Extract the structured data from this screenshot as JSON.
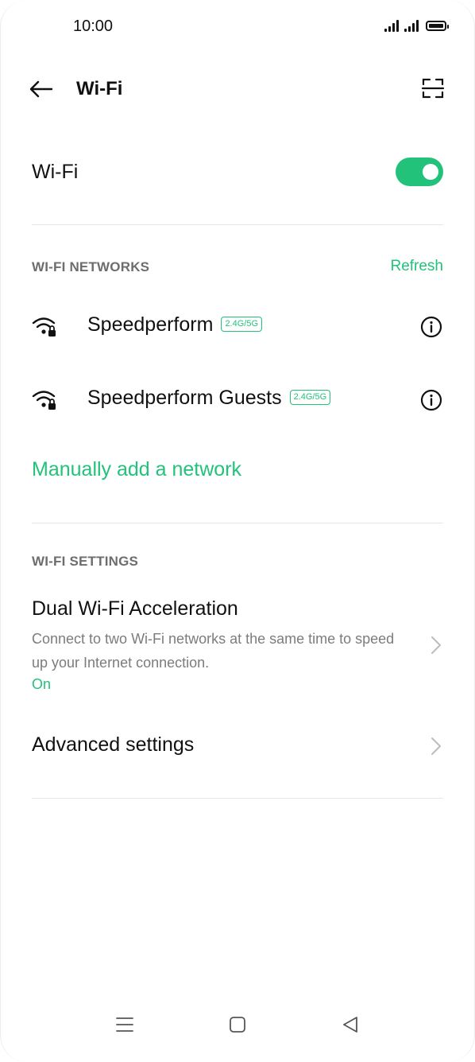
{
  "status_bar": {
    "time": "10:00",
    "icons": [
      "signal-icon",
      "signal-icon",
      "battery-icon"
    ]
  },
  "header": {
    "title": "Wi-Fi",
    "back_icon": "back-arrow-icon",
    "scan_icon": "qr-scan-icon"
  },
  "wifi_toggle": {
    "label": "Wi-Fi",
    "state": "on"
  },
  "networks_section": {
    "header": "WI-FI NETWORKS",
    "refresh_label": "Refresh",
    "networks": [
      {
        "name": "Speedperform",
        "band": "2.4G/5G",
        "icon": "wifi-locked-icon",
        "info_icon": "info-icon"
      },
      {
        "name": "Speedperform Guests",
        "band": "2.4G/5G",
        "icon": "wifi-locked-icon",
        "info_icon": "info-icon"
      }
    ],
    "manual_add_label": "Manually add a network"
  },
  "settings_section": {
    "header": "WI-FI SETTINGS",
    "items": [
      {
        "title": "Dual Wi-Fi Acceleration",
        "description": "Connect to two Wi-Fi networks at the same time to speed up your Internet connection.",
        "status": "On"
      },
      {
        "title": "Advanced settings"
      }
    ]
  },
  "nav_bar": {
    "buttons": [
      "menu-icon",
      "home-icon",
      "back-triangle-icon"
    ]
  },
  "colors": {
    "accent": "#23c27a",
    "text": "#111111",
    "secondary_text": "#7c7c7c",
    "divider": "#e6e6e6"
  }
}
